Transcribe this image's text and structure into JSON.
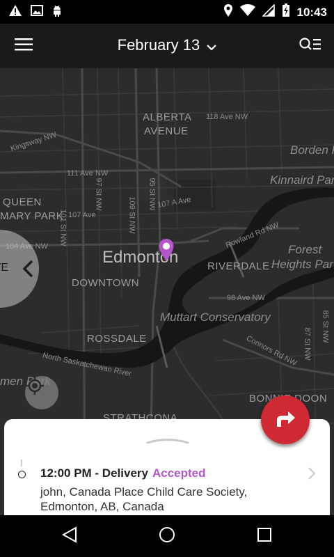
{
  "status_bar": {
    "time": "10:43",
    "icons_left": [
      "warning-icon",
      "image-icon",
      "android-icon"
    ],
    "icons_right": [
      "location-icon",
      "wifi-icon",
      "signal-icon",
      "battery-charging-icon"
    ]
  },
  "header": {
    "date": "February 13",
    "menu_icon": "hamburger-menu-icon",
    "search_icon": "search-list-icon"
  },
  "map": {
    "labels": {
      "alberta_avenue_1": "ALBERTA",
      "alberta_avenue_2": "AVENUE",
      "ave_118": "118 Ave NW",
      "kingsway": "Kingsway NW",
      "borden_park": "Borden Pa",
      "ave_111": "111 Ave NW",
      "st_97": "97 St NW",
      "st_95": "95 St NW",
      "kinnaird_park": "Kinnaird Par",
      "queen_mary_park_1": "QUEEN",
      "queen_mary_park_2": "MARY PARK",
      "ave_107": "107 A Ave",
      "ave_107b": "107 Ave",
      "st_101": "101 St NW",
      "st_109": "109 St NW",
      "rowland_rd": "Rowland Rd NW",
      "ave_104": "104 Ave NW",
      "edmonton": "Edmonton",
      "forest_heights_1": "Forest",
      "forest_heights_2": "Heights Par",
      "riverdale": "RIVERDALE",
      "downtown": "DOWNTOWN",
      "ave_98": "98 Ave NW",
      "muttart": "Muttart Conservatory",
      "rossdale": "ROSSDALE",
      "connors_rd": "Connors Rd NW",
      "st_87": "87 St NW",
      "st_85": "85 St NW",
      "river": "North Saskatchewan River",
      "men_park": "men Park",
      "bonnie_doon": "BONNIE DOON",
      "strathcona": "STRATHCONA"
    },
    "pin_color": "#b455c9",
    "prev_button_icon": "chevron-left-icon",
    "prev_button_partial_text": "VE"
  },
  "fab": {
    "icon": "directions-arrow-icon",
    "color": "#cf2a33"
  },
  "stop": {
    "title": "12:00 PM - Delivery",
    "status": "Accepted",
    "status_color": "#b455c9",
    "address_line1": "john, Canada Place Child Care Society,",
    "address_line2": "Edmonton, AB, Canada"
  },
  "nav_bar": {
    "back": "back-triangle-icon",
    "home": "home-circle-icon",
    "recents": "recents-square-icon"
  }
}
